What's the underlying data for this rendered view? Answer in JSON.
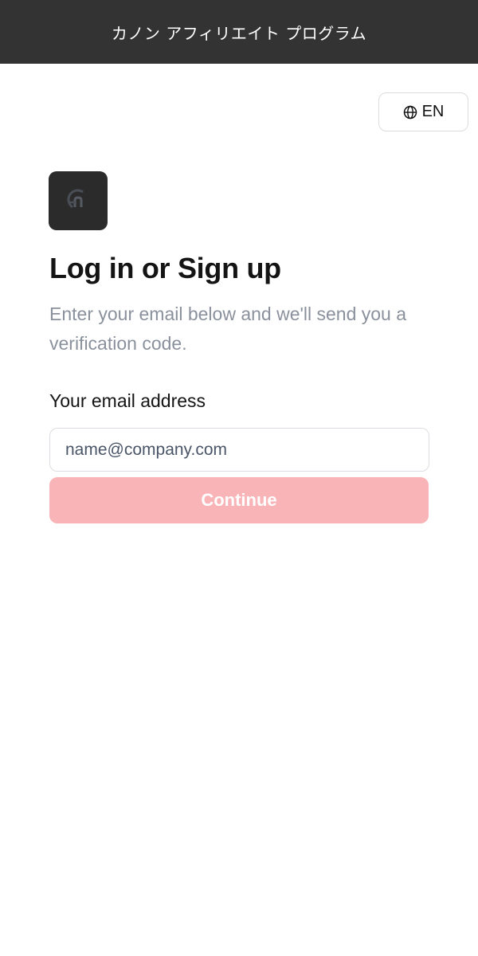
{
  "header": {
    "title": "カノン アフィリエイト プログラム"
  },
  "language": {
    "label": "EN",
    "icon": "globe-icon"
  },
  "logo": {
    "icon": "brand-logo-icon"
  },
  "main": {
    "heading": "Log in or Sign up",
    "subtext": "Enter your email below and we'll send you a verification code.",
    "email_label": "Your email address",
    "email_placeholder": "name@company.com",
    "email_value": "",
    "continue_label": "Continue"
  },
  "colors": {
    "topbar": "#333333",
    "button": "#f9b4b8",
    "subtext": "#8a919d"
  }
}
